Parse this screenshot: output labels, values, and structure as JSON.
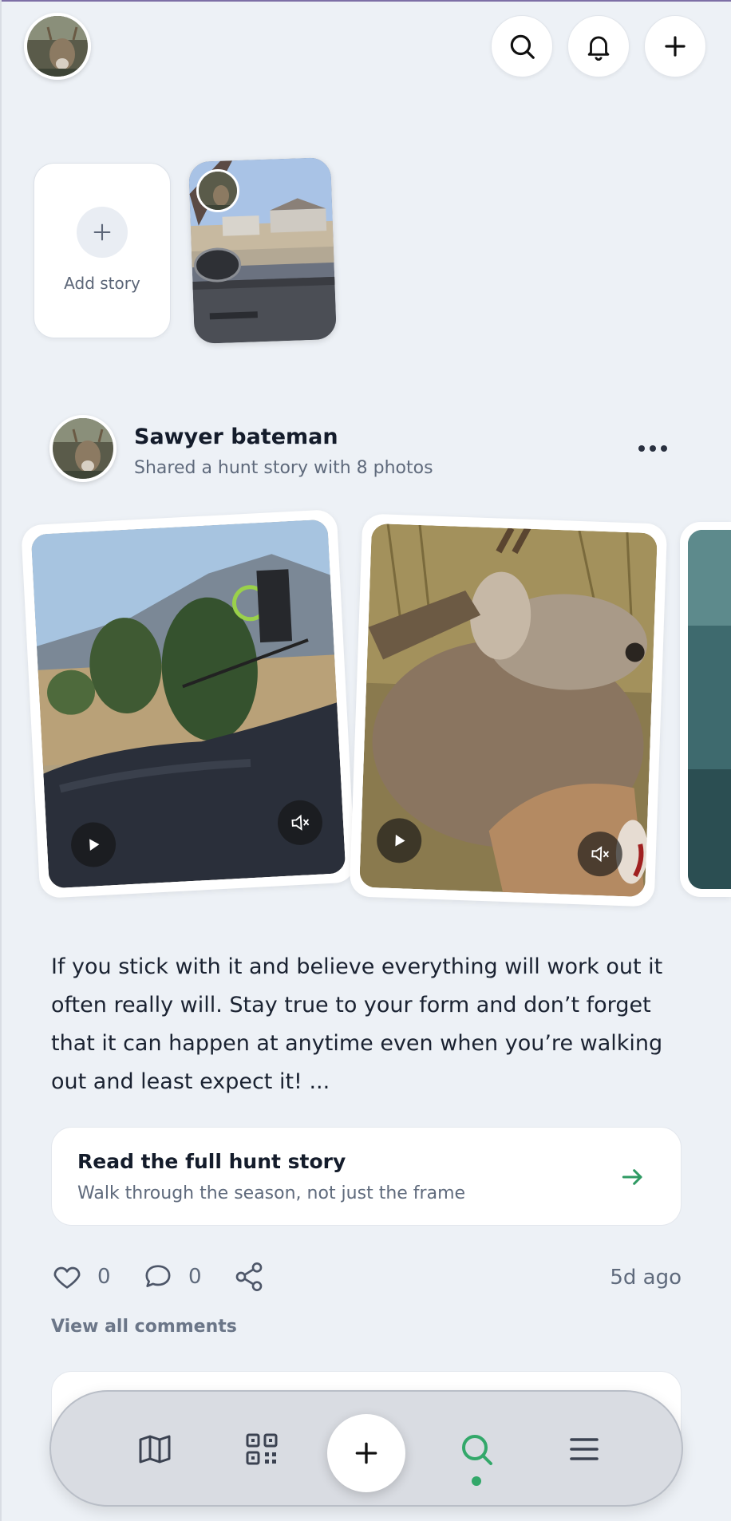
{
  "header": {
    "avatar_icon": "user-avatar",
    "buttons": [
      {
        "name": "search-button",
        "icon": "search-icon"
      },
      {
        "name": "notifications-button",
        "icon": "bell-icon"
      },
      {
        "name": "create-button",
        "icon": "plus-icon"
      }
    ]
  },
  "stories": {
    "add_label": "Add story",
    "items": [
      {
        "thumb": "car-window-photo"
      }
    ]
  },
  "post": {
    "author": "Sawyer bateman",
    "subtitle": "Shared a hunt story with 8 photos",
    "caption": "If you stick with it and believe everything will work out it often really will. Stay true to your form and don’t forget that it can happen at anytime even when you’re walking out and least expect it! ...",
    "read_card": {
      "title": "Read the full hunt story",
      "subtitle": "Walk through the season, not just the frame"
    },
    "likes": "0",
    "comments": "0",
    "time": "5d ago",
    "view_comments": "View all comments"
  },
  "nav": {
    "items": [
      "map-icon",
      "qr-code-icon",
      "plus-icon",
      "search-icon",
      "menu-icon"
    ],
    "active": "search-icon"
  },
  "colors": {
    "background": "#edf1f6",
    "accent": "#33a86a",
    "text": "#141c2b",
    "muted": "#5f6a7c"
  }
}
